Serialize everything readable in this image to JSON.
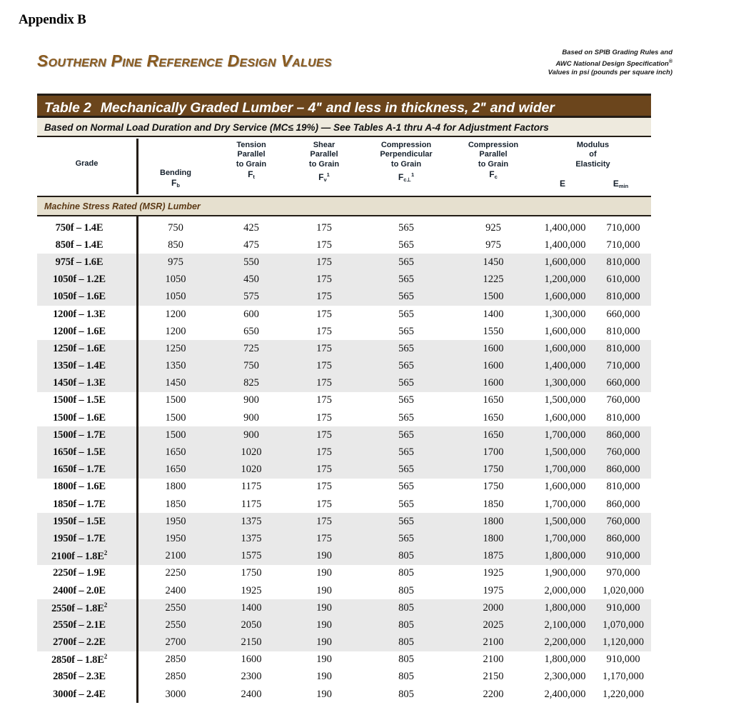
{
  "page": {
    "appendix_heading": "Appendix B"
  },
  "masthead": {
    "brand_title": "Southern Pine Reference Design Values",
    "note_line1": "Based on SPIB Grading Rules and",
    "note_line2": "AWC National Design Specification",
    "note_line2_sup": "®",
    "note_line3": "Values in psi (pounds per square inch)"
  },
  "table": {
    "number_label": "Table 2",
    "title": "Mechanically Graded Lumber – 4ʺ and less in thickness, 2ʺ and wider",
    "subtitle": "Based on Normal Load Duration and Dry Service (MC≤ 19%) — See Tables A-1 thru A-4 for Adjustment Factors",
    "section_header": "Machine Stress Rated (MSR) Lumber",
    "colors": {
      "title_band": "#6b451c",
      "subtitle_band": "#eeeade",
      "section_band": "#e6e0cf",
      "row_shade": "#e9e9e9",
      "rule": "#231d16",
      "brand_brown": "#8a5a1e"
    },
    "columns": {
      "grade": {
        "label": "Grade"
      },
      "bending": {
        "label": "Bending",
        "symbol": "F",
        "sub": "b"
      },
      "tension": {
        "l1": "Tension",
        "l2": "Parallel",
        "l3": "to Grain",
        "symbol": "F",
        "sub": "t"
      },
      "shear": {
        "l1": "Shear",
        "l2": "Parallel",
        "l3": "to Grain",
        "symbol": "F",
        "sub": "v",
        "sup": "1"
      },
      "comp_perp": {
        "l1": "Compression",
        "l2": "Perpendicular",
        "l3": "to Grain",
        "symbol": "F",
        "sub": "c⊥",
        "sup": "1"
      },
      "comp_par": {
        "l1": "Compression",
        "l2": "Parallel",
        "l3": "to Grain",
        "symbol": "F",
        "sub": "c"
      },
      "moe": {
        "l1": "Modulus",
        "l2": "of",
        "l3": "Elasticity",
        "e_symbol": "E",
        "emin_symbol": "E",
        "emin_sub": "min"
      }
    }
  },
  "chart_data": {
    "type": "table",
    "title": "Table 2  Mechanically Graded Lumber – 4ʺ and less in thickness, 2ʺ and wider",
    "columns": [
      "Grade",
      "Bending Fb",
      "Tension Parallel to Grain Ft",
      "Shear Parallel to Grain Fv",
      "Compression Perpendicular to Grain Fc⊥",
      "Compression Parallel to Grain Fc",
      "Modulus of Elasticity E",
      "Modulus of Elasticity Emin"
    ],
    "rows": [
      {
        "grade": "750f – 1.4E",
        "sup": "",
        "fb": "750",
        "ft": "425",
        "fv": "175",
        "fcp": "565",
        "fc": "925",
        "e": "1,400,000",
        "emin": "710,000",
        "shade": false
      },
      {
        "grade": "850f – 1.4E",
        "sup": "",
        "fb": "850",
        "ft": "475",
        "fv": "175",
        "fcp": "565",
        "fc": "975",
        "e": "1,400,000",
        "emin": "710,000",
        "shade": false
      },
      {
        "grade": "975f – 1.6E",
        "sup": "",
        "fb": "975",
        "ft": "550",
        "fv": "175",
        "fcp": "565",
        "fc": "1450",
        "e": "1,600,000",
        "emin": "810,000",
        "shade": true
      },
      {
        "grade": "1050f – 1.2E",
        "sup": "",
        "fb": "1050",
        "ft": "450",
        "fv": "175",
        "fcp": "565",
        "fc": "1225",
        "e": "1,200,000",
        "emin": "610,000",
        "shade": true
      },
      {
        "grade": "1050f – 1.6E",
        "sup": "",
        "fb": "1050",
        "ft": "575",
        "fv": "175",
        "fcp": "565",
        "fc": "1500",
        "e": "1,600,000",
        "emin": "810,000",
        "shade": true
      },
      {
        "grade": "1200f – 1.3E",
        "sup": "",
        "fb": "1200",
        "ft": "600",
        "fv": "175",
        "fcp": "565",
        "fc": "1400",
        "e": "1,300,000",
        "emin": "660,000",
        "shade": false
      },
      {
        "grade": "1200f – 1.6E",
        "sup": "",
        "fb": "1200",
        "ft": "650",
        "fv": "175",
        "fcp": "565",
        "fc": "1550",
        "e": "1,600,000",
        "emin": "810,000",
        "shade": false
      },
      {
        "grade": "1250f – 1.6E",
        "sup": "",
        "fb": "1250",
        "ft": "725",
        "fv": "175",
        "fcp": "565",
        "fc": "1600",
        "e": "1,600,000",
        "emin": "810,000",
        "shade": true
      },
      {
        "grade": "1350f – 1.4E",
        "sup": "",
        "fb": "1350",
        "ft": "750",
        "fv": "175",
        "fcp": "565",
        "fc": "1600",
        "e": "1,400,000",
        "emin": "710,000",
        "shade": true
      },
      {
        "grade": "1450f – 1.3E",
        "sup": "",
        "fb": "1450",
        "ft": "825",
        "fv": "175",
        "fcp": "565",
        "fc": "1600",
        "e": "1,300,000",
        "emin": "660,000",
        "shade": true
      },
      {
        "grade": "1500f – 1.5E",
        "sup": "",
        "fb": "1500",
        "ft": "900",
        "fv": "175",
        "fcp": "565",
        "fc": "1650",
        "e": "1,500,000",
        "emin": "760,000",
        "shade": false
      },
      {
        "grade": "1500f – 1.6E",
        "sup": "",
        "fb": "1500",
        "ft": "900",
        "fv": "175",
        "fcp": "565",
        "fc": "1650",
        "e": "1,600,000",
        "emin": "810,000",
        "shade": false
      },
      {
        "grade": "1500f – 1.7E",
        "sup": "",
        "fb": "1500",
        "ft": "900",
        "fv": "175",
        "fcp": "565",
        "fc": "1650",
        "e": "1,700,000",
        "emin": "860,000",
        "shade": true
      },
      {
        "grade": "1650f – 1.5E",
        "sup": "",
        "fb": "1650",
        "ft": "1020",
        "fv": "175",
        "fcp": "565",
        "fc": "1700",
        "e": "1,500,000",
        "emin": "760,000",
        "shade": true
      },
      {
        "grade": "1650f – 1.7E",
        "sup": "",
        "fb": "1650",
        "ft": "1020",
        "fv": "175",
        "fcp": "565",
        "fc": "1750",
        "e": "1,700,000",
        "emin": "860,000",
        "shade": true
      },
      {
        "grade": "1800f – 1.6E",
        "sup": "",
        "fb": "1800",
        "ft": "1175",
        "fv": "175",
        "fcp": "565",
        "fc": "1750",
        "e": "1,600,000",
        "emin": "810,000",
        "shade": false
      },
      {
        "grade": "1850f – 1.7E",
        "sup": "",
        "fb": "1850",
        "ft": "1175",
        "fv": "175",
        "fcp": "565",
        "fc": "1850",
        "e": "1,700,000",
        "emin": "860,000",
        "shade": false
      },
      {
        "grade": "1950f – 1.5E",
        "sup": "",
        "fb": "1950",
        "ft": "1375",
        "fv": "175",
        "fcp": "565",
        "fc": "1800",
        "e": "1,500,000",
        "emin": "760,000",
        "shade": true
      },
      {
        "grade": "1950f – 1.7E",
        "sup": "",
        "fb": "1950",
        "ft": "1375",
        "fv": "175",
        "fcp": "565",
        "fc": "1800",
        "e": "1,700,000",
        "emin": "860,000",
        "shade": true
      },
      {
        "grade": "2100f – 1.8E",
        "sup": "2",
        "fb": "2100",
        "ft": "1575",
        "fv": "190",
        "fcp": "805",
        "fc": "1875",
        "e": "1,800,000",
        "emin": "910,000",
        "shade": true
      },
      {
        "grade": "2250f – 1.9E",
        "sup": "",
        "fb": "2250",
        "ft": "1750",
        "fv": "190",
        "fcp": "805",
        "fc": "1925",
        "e": "1,900,000",
        "emin": "970,000",
        "shade": false
      },
      {
        "grade": "2400f – 2.0E",
        "sup": "",
        "fb": "2400",
        "ft": "1925",
        "fv": "190",
        "fcp": "805",
        "fc": "1975",
        "e": "2,000,000",
        "emin": "1,020,000",
        "shade": false
      },
      {
        "grade": "2550f – 1.8E",
        "sup": "2",
        "fb": "2550",
        "ft": "1400",
        "fv": "190",
        "fcp": "805",
        "fc": "2000",
        "e": "1,800,000",
        "emin": "910,000",
        "shade": true
      },
      {
        "grade": "2550f – 2.1E",
        "sup": "",
        "fb": "2550",
        "ft": "2050",
        "fv": "190",
        "fcp": "805",
        "fc": "2025",
        "e": "2,100,000",
        "emin": "1,070,000",
        "shade": true
      },
      {
        "grade": "2700f – 2.2E",
        "sup": "",
        "fb": "2700",
        "ft": "2150",
        "fv": "190",
        "fcp": "805",
        "fc": "2100",
        "e": "2,200,000",
        "emin": "1,120,000",
        "shade": true
      },
      {
        "grade": "2850f – 1.8E",
        "sup": "2",
        "fb": "2850",
        "ft": "1600",
        "fv": "190",
        "fcp": "805",
        "fc": "2100",
        "e": "1,800,000",
        "emin": "910,000",
        "shade": false
      },
      {
        "grade": "2850f – 2.3E",
        "sup": "",
        "fb": "2850",
        "ft": "2300",
        "fv": "190",
        "fcp": "805",
        "fc": "2150",
        "e": "2,300,000",
        "emin": "1,170,000",
        "shade": false
      },
      {
        "grade": "3000f – 2.4E",
        "sup": "",
        "fb": "3000",
        "ft": "2400",
        "fv": "190",
        "fcp": "805",
        "fc": "2200",
        "e": "2,400,000",
        "emin": "1,220,000",
        "shade": false
      }
    ]
  }
}
